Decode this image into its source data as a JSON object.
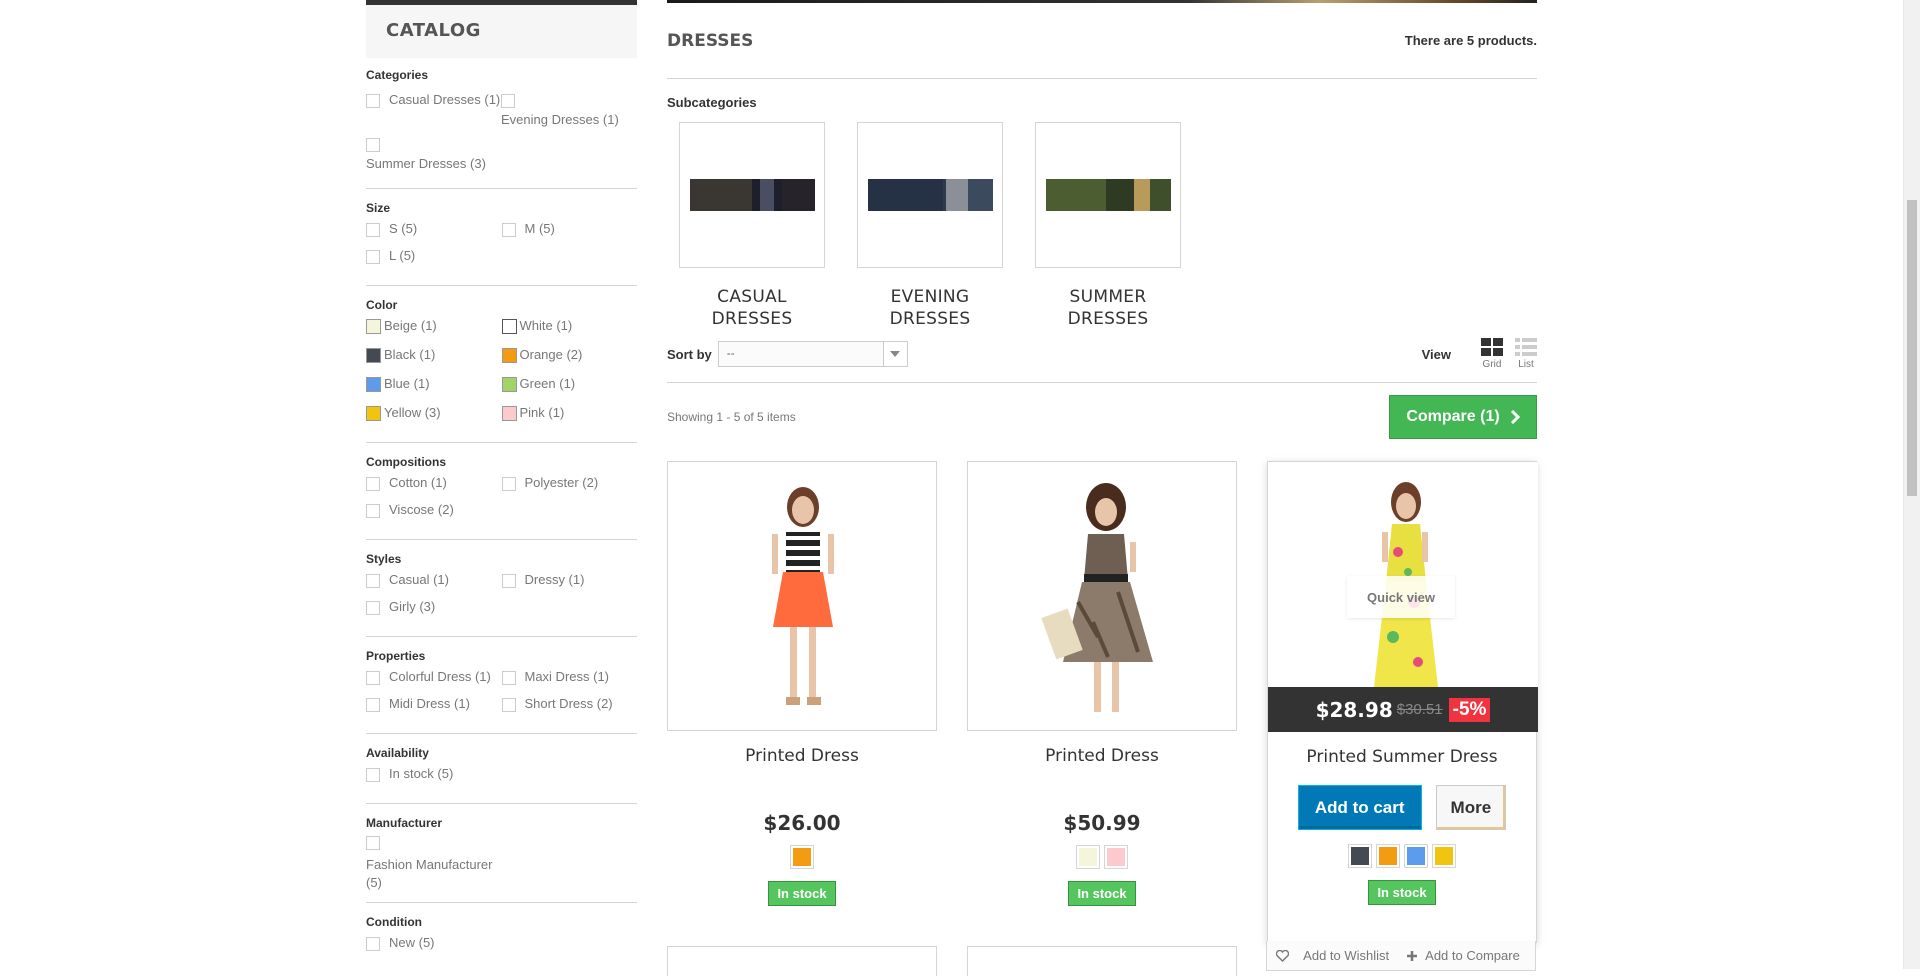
{
  "sidebar": {
    "title": "CATALOG",
    "groups": [
      {
        "title": "Categories",
        "options": [
          "Casual Dresses (1)",
          "Evening Dresses (1)",
          "Summer Dresses (3)"
        ]
      },
      {
        "title": "Size",
        "options": [
          "S (5)",
          "M (5)",
          "L (5)"
        ]
      },
      {
        "title": "Color",
        "options": [
          {
            "label": "Beige (1)",
            "color": "#f5f5dc"
          },
          {
            "label": "White (1)",
            "color": "#ffffff"
          },
          {
            "label": "Black (1)",
            "color": "#434a54"
          },
          {
            "label": "Orange (2)",
            "color": "#f39c11"
          },
          {
            "label": "Blue (1)",
            "color": "#5d9cec"
          },
          {
            "label": "Green (1)",
            "color": "#a0d468"
          },
          {
            "label": "Yellow (3)",
            "color": "#f1c40f"
          },
          {
            "label": "Pink (1)",
            "color": "#fccacd"
          }
        ]
      },
      {
        "title": "Compositions",
        "options": [
          "Cotton (1)",
          "Polyester (2)",
          "Viscose (2)"
        ]
      },
      {
        "title": "Styles",
        "options": [
          "Casual (1)",
          "Dressy (1)",
          "Girly (3)"
        ]
      },
      {
        "title": "Properties",
        "options": [
          "Colorful Dress (1)",
          "Maxi Dress (1)",
          "Midi Dress (1)",
          "Short Dress (2)"
        ]
      },
      {
        "title": "Availability",
        "options": [
          "In stock (5)"
        ]
      },
      {
        "title": "Manufacturer",
        "options": [
          "Fashion Manufacturer (5)"
        ]
      },
      {
        "title": "Condition",
        "options": [
          "New (5)"
        ]
      }
    ]
  },
  "category": {
    "name": "DRESSES",
    "count": "There are 5 products.",
    "subcategories_title": "Subcategories",
    "subcategories": [
      {
        "line1": "CASUAL",
        "line2": "DRESSES"
      },
      {
        "line1": "EVENING",
        "line2": "DRESSES"
      },
      {
        "line1": "SUMMER",
        "line2": "DRESSES"
      }
    ]
  },
  "toolbar": {
    "sort_label": "Sort by",
    "sort_value": "--",
    "view_label": "View",
    "grid_label": "Grid",
    "list_label": "List",
    "showing": "Showing 1 - 5 of 5 items",
    "compare": "Compare (1)"
  },
  "products": [
    {
      "name": "Printed Dress",
      "price": "$26.00",
      "stock": "In stock",
      "colors": [
        "#f39c11"
      ]
    },
    {
      "name": "Printed Dress",
      "price": "$50.99",
      "stock": "In stock",
      "colors": [
        "#f5f5dc",
        "#fccacd"
      ]
    },
    {
      "name": "Printed Summer Dress",
      "price": "$28.98",
      "old_price": "$30.51",
      "discount": "-5%",
      "stock": "In stock",
      "colors": [
        "#434a54",
        "#f39c11",
        "#5d9cec",
        "#f1c40f"
      ],
      "quick_view": "Quick view",
      "add_to_cart": "Add to cart",
      "more": "More",
      "wishlist": "Add to Wishlist",
      "compare": "Add to Compare"
    }
  ]
}
